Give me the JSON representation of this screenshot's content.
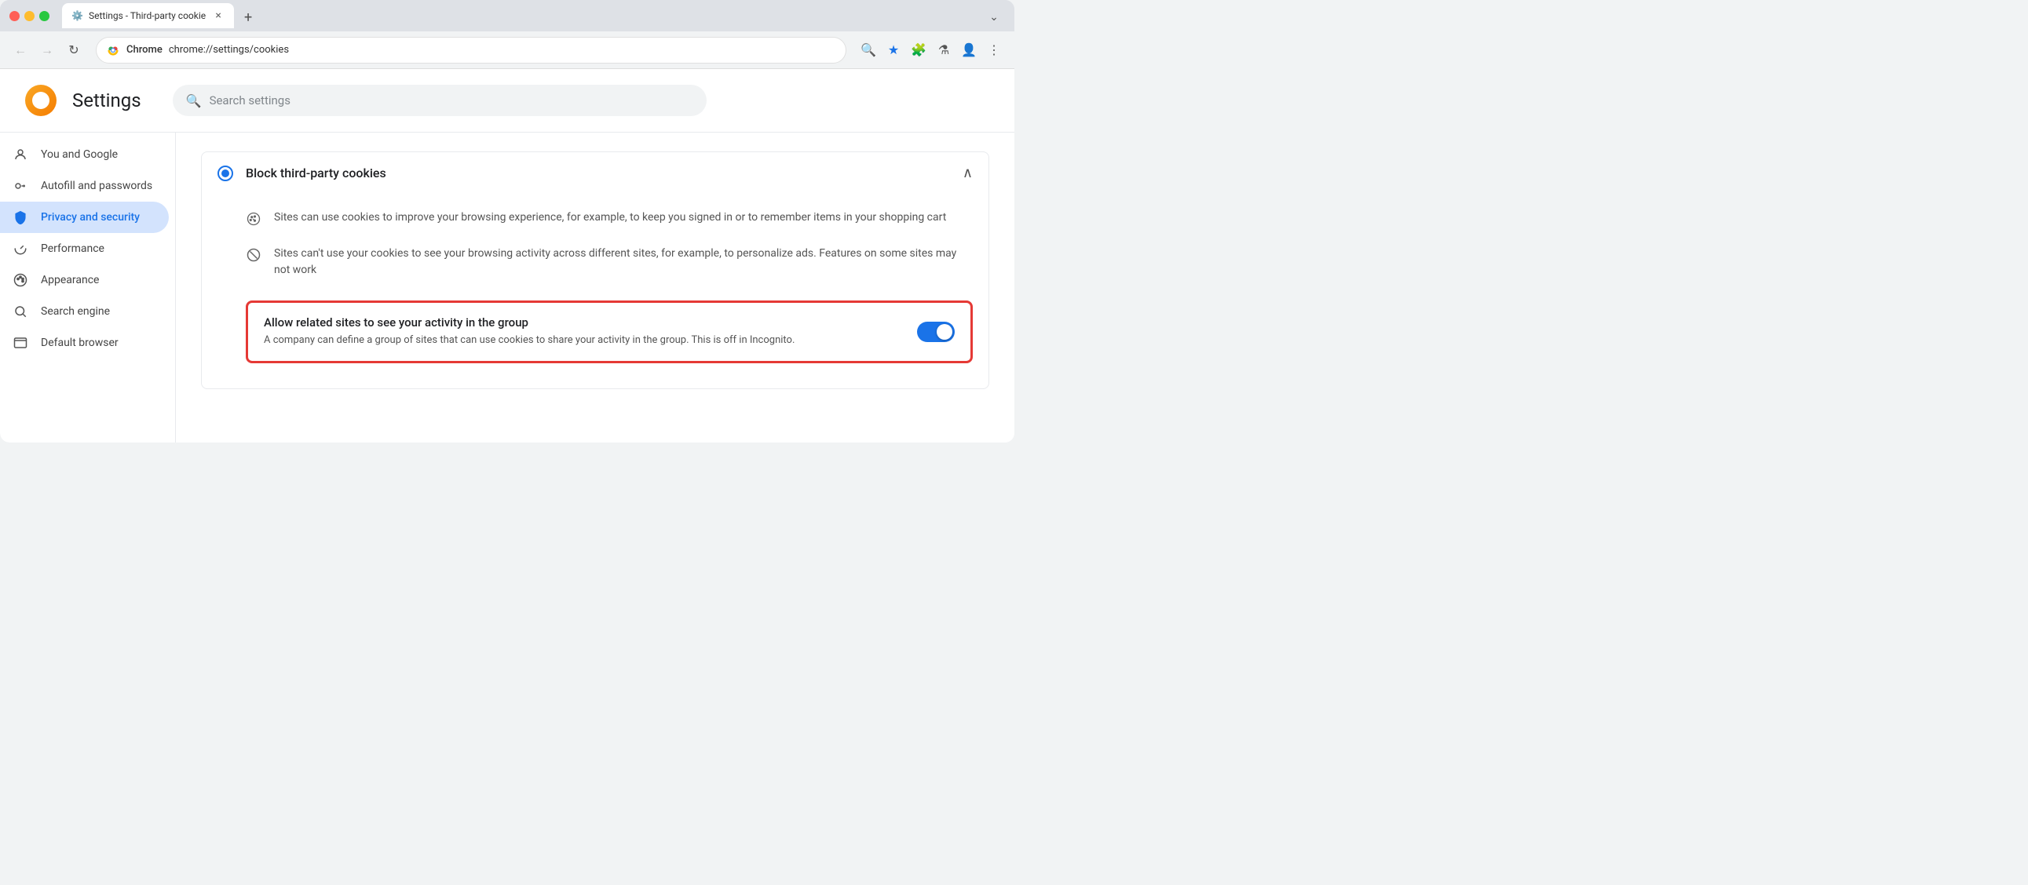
{
  "browser": {
    "tab": {
      "title": "Settings - Third-party cookie",
      "close_label": "×",
      "new_tab_label": "+"
    },
    "dropdown_label": "⌄",
    "nav": {
      "back_label": "←",
      "forward_label": "→",
      "refresh_label": "↻",
      "brand": "Chrome",
      "url": "chrome://settings/cookies",
      "search_icon": "🔍",
      "star_icon": "★",
      "extension_icon": "🧩",
      "flask_icon": "⚗",
      "profile_icon": "👤",
      "menu_icon": "⋮"
    }
  },
  "settings": {
    "logo_alt": "Chrome settings logo",
    "title": "Settings",
    "search_placeholder": "Search settings",
    "sidebar": {
      "items": [
        {
          "id": "you-and-google",
          "label": "You and Google",
          "icon": "person"
        },
        {
          "id": "autofill",
          "label": "Autofill and passwords",
          "icon": "key"
        },
        {
          "id": "privacy",
          "label": "Privacy and security",
          "icon": "shield",
          "active": true
        },
        {
          "id": "performance",
          "label": "Performance",
          "icon": "gauge"
        },
        {
          "id": "appearance",
          "label": "Appearance",
          "icon": "palette"
        },
        {
          "id": "search-engine",
          "label": "Search engine",
          "icon": "search"
        },
        {
          "id": "default-browser",
          "label": "Default browser",
          "icon": "browser"
        }
      ]
    },
    "main": {
      "section": {
        "title": "Block third-party cookies",
        "info1": {
          "text": "Sites can use cookies to improve your browsing experience, for example, to keep you signed in or to remember items in your shopping cart"
        },
        "info2": {
          "text": "Sites can't use your cookies to see your browsing activity across different sites, for example, to personalize ads. Features on some sites may not work"
        }
      },
      "toggle_card": {
        "title": "Allow related sites to see your activity in the group",
        "description": "A company can define a group of sites that can use cookies to share your activity in the group. This is off in Incognito.",
        "enabled": true
      }
    }
  }
}
